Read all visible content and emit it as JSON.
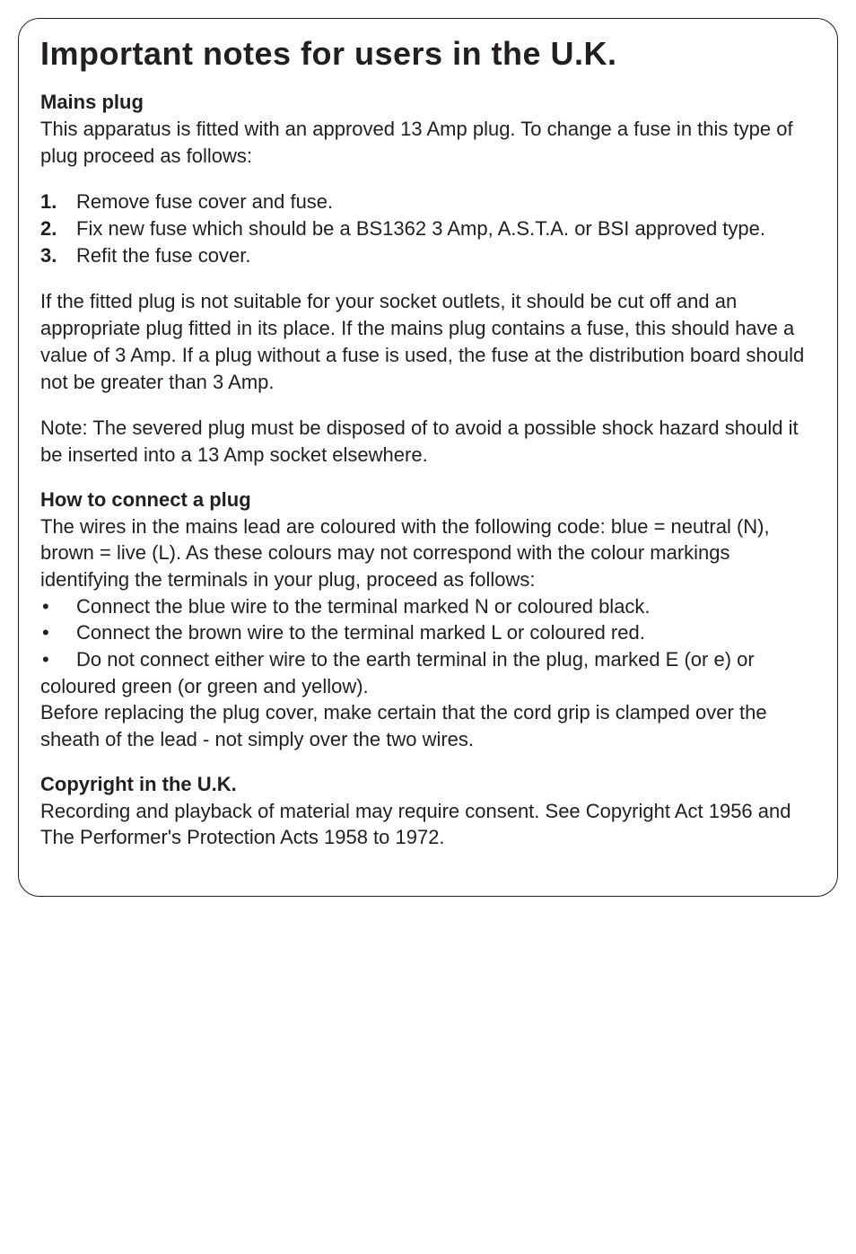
{
  "title": "Important notes for users in the U.K.",
  "mains_plug": {
    "heading": "Mains plug",
    "intro": "This apparatus is fitted with an approved 13 Amp plug. To change a fuse in this type of plug proceed as follows:",
    "steps": [
      {
        "num": "1.",
        "text": "Remove fuse cover and fuse."
      },
      {
        "num": "2.",
        "text": "Fix new fuse which should be a BS1362 3 Amp, A.S.T.A. or BSI approved type."
      },
      {
        "num": "3.",
        "text": "Refit the fuse cover."
      }
    ],
    "para1": "If the fitted plug is not suitable for your socket outlets, it should be cut off and an appropriate plug fitted in its place. If the mains plug contains a fuse, this should have a value of 3 Amp. If a plug without a fuse is used, the fuse at the distribution board should not be greater than 3 Amp.",
    "note": "Note: The severed plug must be disposed of to avoid a possible shock hazard should it be inserted into a 13 Amp socket elsewhere."
  },
  "connect_plug": {
    "heading": "How to connect a plug",
    "intro": "The wires in the mains lead are coloured with the following code: blue = neutral (N), brown = live (L). As these colours may not correspond with the colour markings identifying the terminals in your plug, proceed as follows:",
    "bullets": [
      "Connect the blue wire to the terminal marked N or coloured black.",
      "Connect the brown wire to the terminal marked L or coloured red.",
      "Do not connect either wire to the earth terminal in the plug, marked E (or e) or"
    ],
    "bullet3_cont": "coloured green (or green and yellow).",
    "outro": "Before replacing the plug cover, make certain that the cord grip is clamped over the sheath of the lead - not simply over the two wires."
  },
  "copyright": {
    "heading": "Copyright in the U.K.",
    "text": "Recording and playback of material may require consent. See Copyright Act 1956 and The Performer's Protection Acts 1958 to 1972."
  }
}
